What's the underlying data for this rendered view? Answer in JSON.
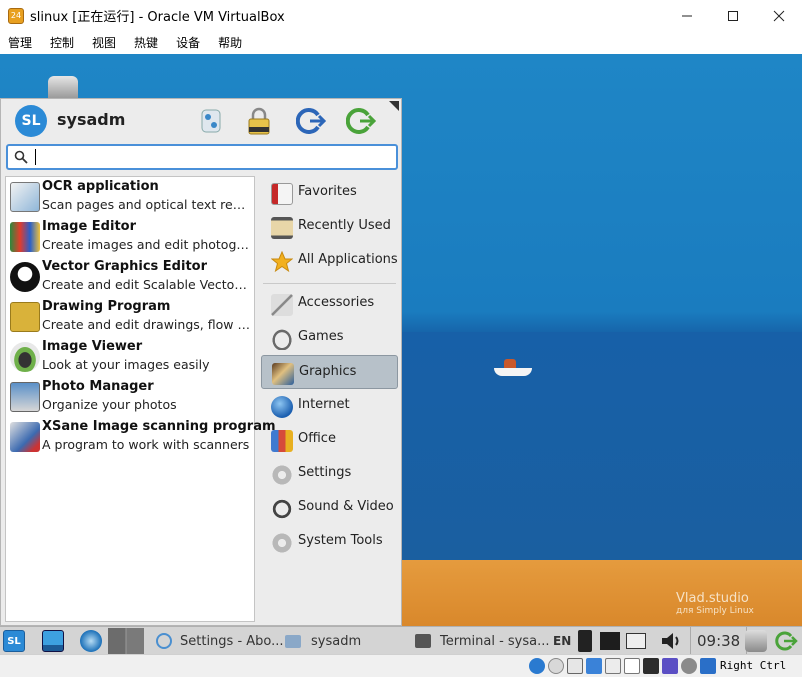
{
  "window": {
    "title": "slinux [正在运行] - Oracle VM VirtualBox",
    "menu": [
      "管理",
      "控制",
      "视图",
      "热键",
      "设备",
      "帮助"
    ]
  },
  "whisker": {
    "username": "sysadm",
    "search": {
      "value": "",
      "placeholder": ""
    },
    "apps": [
      {
        "name": "OCR application",
        "desc": "Scan pages and optical text recognition",
        "icon": "ocr-icon"
      },
      {
        "name": "Image Editor",
        "desc": "Create images and edit photographs",
        "icon": "image-editor-icon"
      },
      {
        "name": "Vector Graphics Editor",
        "desc": "Create and edit Scalable Vector Graphics",
        "icon": "vector-graphics-icon"
      },
      {
        "name": "Drawing Program",
        "desc": "Create and edit drawings, flow charts",
        "icon": "drawing-icon"
      },
      {
        "name": "Image Viewer",
        "desc": "Look at your images easily",
        "icon": "image-viewer-icon"
      },
      {
        "name": "Photo Manager",
        "desc": "Organize your photos",
        "icon": "photo-manager-icon"
      },
      {
        "name": "XSane Image scanning program",
        "desc": "A program to work with scanners",
        "icon": "scanner-icon"
      }
    ],
    "categories_top": [
      {
        "label": "Favorites",
        "icon": "bookmark-icon"
      },
      {
        "label": "Recently Used",
        "icon": "hourglass-icon"
      },
      {
        "label": "All Applications",
        "icon": "star-icon"
      }
    ],
    "categories": [
      {
        "label": "Accessories",
        "icon": "accessories-icon"
      },
      {
        "label": "Games",
        "icon": "gamepad-icon"
      },
      {
        "label": "Graphics",
        "icon": "graphics-icon",
        "active": true
      },
      {
        "label": "Internet",
        "icon": "globe-icon"
      },
      {
        "label": "Office",
        "icon": "office-icon"
      },
      {
        "label": "Settings",
        "icon": "gear-icon"
      },
      {
        "label": "Sound & Video",
        "icon": "headphones-icon"
      },
      {
        "label": "System Tools",
        "icon": "tools-icon"
      }
    ]
  },
  "wallpaper": {
    "watermark": "Vlad.studio",
    "watermark_sub": "для Simply Linux"
  },
  "panel": {
    "tasks": [
      "Settings - Abo...",
      "sysadm",
      "Terminal - sysa..."
    ],
    "keyboard_layout": "EN",
    "clock": "09:38"
  },
  "statusbar": {
    "host_key": "Right Ctrl"
  },
  "colors": {
    "accent": "#4a90d9",
    "sea": "#1a7cbf",
    "sand": "#e59b3e",
    "menu_bg": "#ececec"
  }
}
